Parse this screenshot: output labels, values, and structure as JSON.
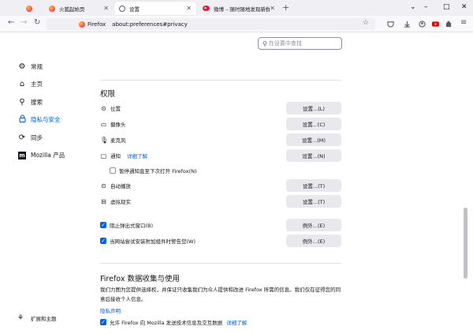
{
  "tabs": [
    {
      "title": "",
      "icon": "firefox-icon",
      "active": false
    },
    {
      "title": "火狐起始页",
      "icon": "firefox-icon",
      "active": false
    },
    {
      "title": "设置",
      "icon": "gear-icon",
      "active": true
    },
    {
      "title": "微博 – 随时随地发现新鲜事",
      "icon": "weibo-icon",
      "active": false
    }
  ],
  "window": {
    "minimize": "–",
    "maximize": "□",
    "close": "✕"
  },
  "nav": {
    "identity": "Firefox",
    "url": "about:preferences#privacy"
  },
  "search": {
    "placeholder": "在设置中查找"
  },
  "sidebar": {
    "items": [
      {
        "label": "常规",
        "icon": "gear-icon"
      },
      {
        "label": "主页",
        "icon": "home-icon"
      },
      {
        "label": "搜索",
        "icon": "search-icon"
      },
      {
        "label": "隐私与安全",
        "icon": "lock-icon"
      },
      {
        "label": "同步",
        "icon": "sync-icon"
      },
      {
        "label": "Mozilla 产品",
        "icon": "mozilla-icon"
      }
    ],
    "footer": "扩展和主题"
  },
  "permissions": {
    "title": "权限",
    "rows": [
      {
        "label": "位置",
        "icon": "location-icon",
        "button": "设置...(L)"
      },
      {
        "label": "摄像头",
        "icon": "camera-icon",
        "button": "设置...(C)"
      },
      {
        "label": "麦克风",
        "icon": "microphone-icon",
        "button": "设置...(M)"
      },
      {
        "label": "通知",
        "icon": "notification-icon",
        "link": "详细了解",
        "button": "设置...(N)"
      },
      {
        "label": "自动播放",
        "icon": "autoplay-icon",
        "button": "设置...(T)"
      },
      {
        "label": "虚拟现实",
        "icon": "vr-icon",
        "button": "设置...(T)"
      }
    ],
    "pause_notifications": "暂停通知直至下次打开 Firefox(N)",
    "block_popups": {
      "label": "阻止弹出式窗口(B)",
      "button": "例外...(E)"
    },
    "warn_addons": {
      "label": "当网站尝试安装附加组件时警告您(W)",
      "button": "例外...(E)"
    }
  },
  "data_collection": {
    "title": "Firefox 数据收集与使用",
    "description": "我们力图为您提供选择权，并保证只收集我们为众人提供和改进 Firefox 所需的信息。我们仅在征得您的同意后接收个人信息。",
    "privacy_link": "隐私声明",
    "allow_label": "允许 Firefox 向 Mozilla 发送技术信息及交互数据",
    "allow_link": "详细了解"
  }
}
